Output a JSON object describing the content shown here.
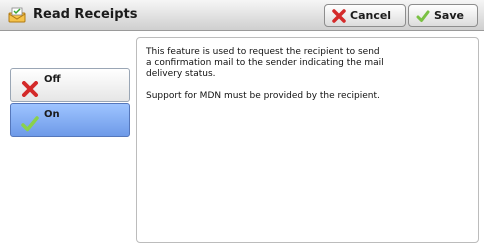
{
  "header": {
    "title": "Read Receipts",
    "title_icon": "envelope-receipt-icon",
    "cancel_label": "Cancel",
    "save_label": "Save"
  },
  "options": {
    "off_label": "Off",
    "on_label": "On",
    "selected": "On"
  },
  "description": {
    "paragraph1": "This feature is used to request the recipient to send\na confirmation mail to the sender indicating the mail\ndelivery status.",
    "paragraph2": "Support for MDN must be provided by the recipient."
  },
  "colors": {
    "selected_option": "#7fa8f0",
    "cancel_icon": "#d42a2a",
    "save_icon": "#7ac143"
  }
}
